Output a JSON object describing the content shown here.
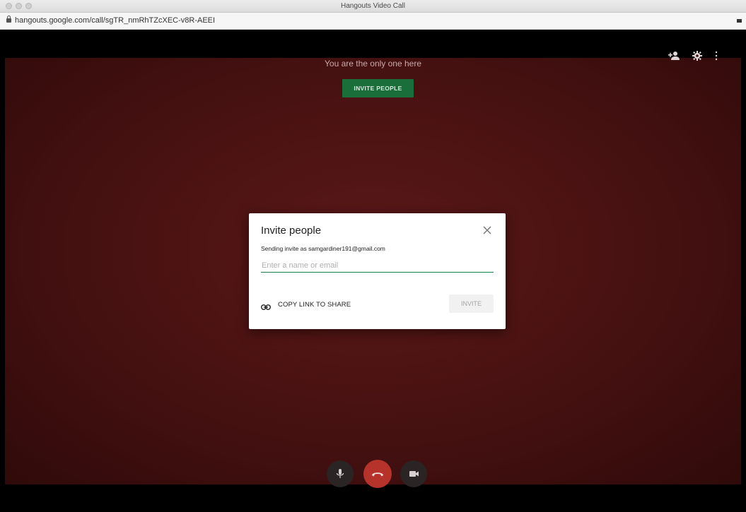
{
  "window": {
    "title": "Hangouts Video Call"
  },
  "urlbar": {
    "url": "hangouts.google.com/call/sgTR_nmRhTZcXEC-v8R-AEEI"
  },
  "call": {
    "status_text": "You are the only one here",
    "invite_people_label": "INVITE PEOPLE",
    "top_icons": [
      "add-person-icon",
      "gear-icon",
      "more-vert-icon"
    ],
    "controls": [
      "microphone-icon",
      "hang-up-icon",
      "camera-icon"
    ]
  },
  "dialog": {
    "title": "Invite people",
    "subtitle": "Sending invite as samgardiner191@gmail.com",
    "input_placeholder": "Enter a name or email",
    "input_value": "",
    "copy_link_label": "COPY LINK TO SHARE",
    "invite_label": "INVITE"
  },
  "colors": {
    "video_bg": "#4a1212",
    "accent_green": "#1a6e3a",
    "hang_up_red": "#b5332a"
  }
}
